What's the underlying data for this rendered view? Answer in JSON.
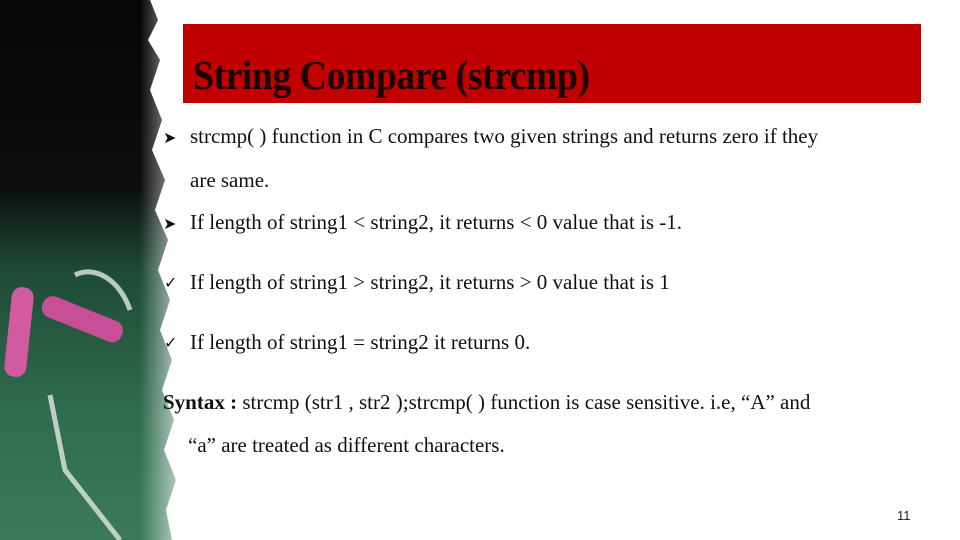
{
  "slide": {
    "title": "String Compare (strcmp)",
    "bullets": [
      {
        "icon": "arrow-bullet-icon",
        "glyph": "➤",
        "lines": [
          "strcmp( ) function in C compares two given strings and returns zero if they",
          "are same."
        ]
      },
      {
        "icon": "arrow-bullet-icon",
        "glyph": "➤",
        "lines": [
          "If length of string1 < string2, it returns < 0 value that is -1."
        ]
      },
      {
        "icon": "check-bullet-icon",
        "glyph": "✓",
        "lines": [
          "If length of string1 > string2, it returns > 0 value that is 1"
        ]
      },
      {
        "icon": "check-bullet-icon",
        "glyph": "✓",
        "lines": [
          "If length of string1 = string2 it returns 0."
        ]
      }
    ],
    "syntax": {
      "label": "Syntax :",
      "text": " strcmp (str1 , str2 );strcmp( ) function is case sensitive. i.e, “A” and",
      "continuation": "“a” are treated as different characters."
    },
    "page_number": "11",
    "colors": {
      "title_bar": "#c00000",
      "chalkboard": "#2f6b4e",
      "chalk": "#d25aa0"
    }
  }
}
